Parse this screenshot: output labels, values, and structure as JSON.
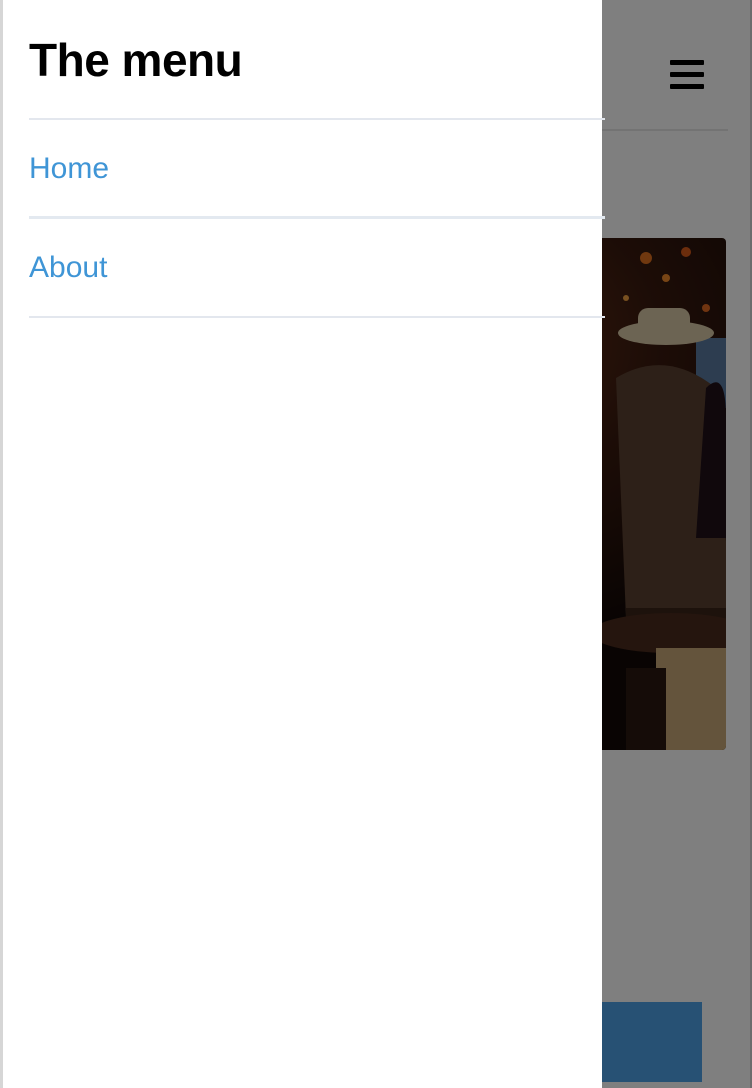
{
  "drawer": {
    "title": "The menu",
    "items": [
      {
        "label": "Home"
      },
      {
        "label": "About"
      }
    ]
  },
  "header": {
    "menu_icon": "hamburger-menu-icon"
  },
  "hero": {
    "image": "photo of a person in a hat at a dimly lit bar"
  },
  "colors": {
    "link": "#3f95d6",
    "overlay": "rgba(0,0,0,0.5)",
    "button": "#4fa3e8",
    "divider": "#e3e7ee"
  }
}
